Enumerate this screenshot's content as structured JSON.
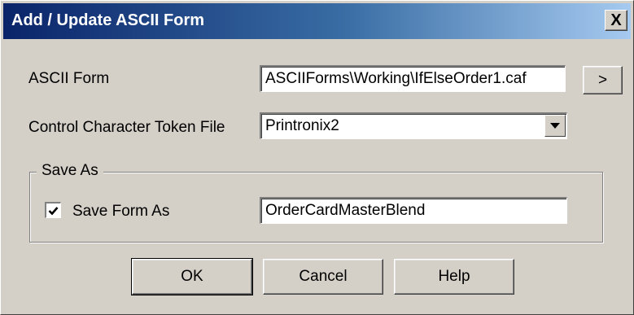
{
  "window": {
    "title": "Add / Update ASCII Form",
    "close_glyph": "X"
  },
  "form": {
    "ascii_form_label": "ASCII Form",
    "ascii_form_value": "ASCIIForms\\Working\\IfElseOrder1.caf",
    "browse_label": ">",
    "token_file_label": "Control Character Token File",
    "token_file_value": "Printronix2"
  },
  "save_as": {
    "group_label": "Save As",
    "checkbox_label": "Save Form As",
    "checked": true,
    "name_value": "OrderCardMasterBlend"
  },
  "buttons": {
    "ok": "OK",
    "cancel": "Cancel",
    "help": "Help"
  },
  "icons": {
    "close": "close-icon",
    "dropdown": "chevron-down-icon",
    "check": "check-icon"
  }
}
